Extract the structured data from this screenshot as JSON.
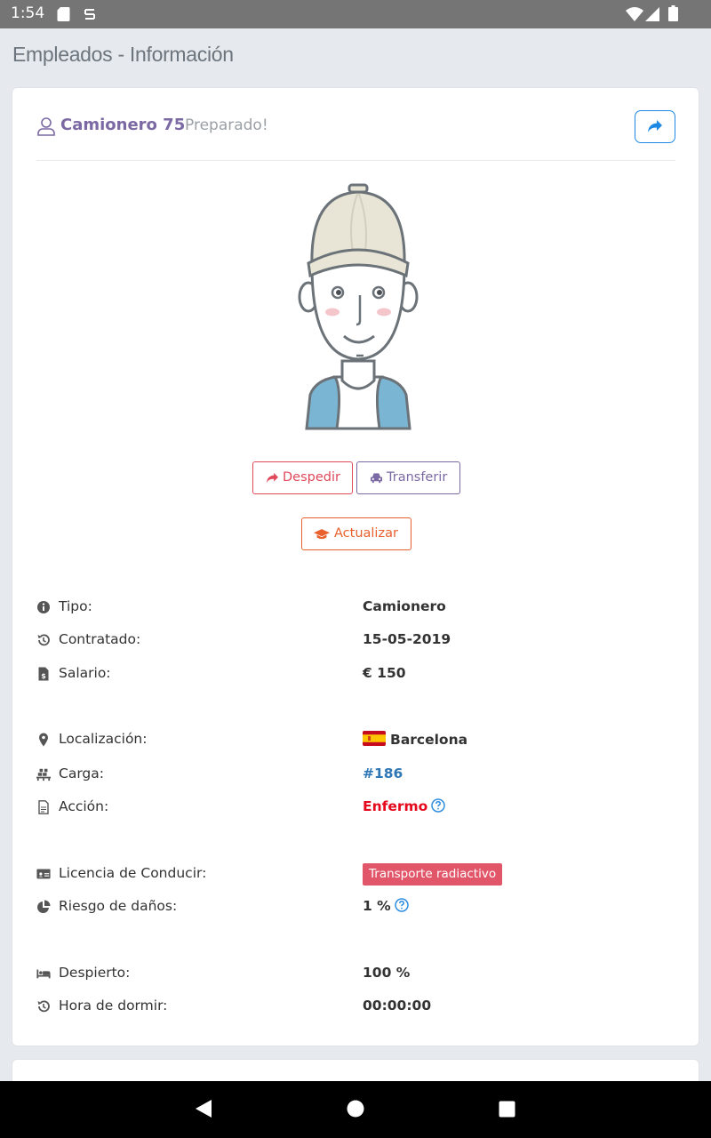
{
  "status_bar": {
    "time": "1:54"
  },
  "page": {
    "title": "Empleados - Información"
  },
  "employee": {
    "name": "Camionero 75",
    "status": "Preparado!"
  },
  "actions": {
    "fire_label": "Despedir",
    "transfer_label": "Transferir",
    "update_label": "Actualizar"
  },
  "info": {
    "tipo": {
      "label": "Tipo:",
      "value": "Camionero"
    },
    "contratado": {
      "label": "Contratado:",
      "value": "15-05-2019"
    },
    "salario": {
      "label": "Salario:",
      "value": "€ 150"
    },
    "localizacion": {
      "label": "Localización:",
      "value": "Barcelona"
    },
    "carga": {
      "label": "Carga:",
      "value": "#186"
    },
    "accion": {
      "label": "Acción:",
      "value": "Enfermo"
    },
    "licencia": {
      "label": "Licencia de Conducir:",
      "value": "Transporte radiactivo"
    },
    "riesgo": {
      "label": "Riesgo de daños:",
      "value": "1 %"
    },
    "despierto": {
      "label": "Despierto:",
      "value": "100 %"
    },
    "hora_dormir": {
      "label": "Hora de dormir:",
      "value": "00:00:00"
    }
  },
  "icons": {
    "user": "user-icon",
    "share": "share-icon",
    "fire": "share-arrow-icon",
    "transfer": "car-icon",
    "update": "graduation-cap-icon",
    "tipo": "info-circle-icon",
    "contratado": "history-icon",
    "salario": "invoice-dollar-icon",
    "localizacion": "map-marker-icon",
    "carga": "pallet-icon",
    "accion": "file-icon",
    "licencia": "id-card-icon",
    "riesgo": "pie-chart-icon",
    "despierto": "bed-icon",
    "hora_dormir": "history-icon",
    "help": "question-circle-icon"
  },
  "colors": {
    "accent_purple": "#7b69a3",
    "danger": "#e0495b",
    "orange": "#e8602c",
    "link_blue": "#2f77b5",
    "badge_red": "#e2566a",
    "status_red": "#e5091d"
  }
}
